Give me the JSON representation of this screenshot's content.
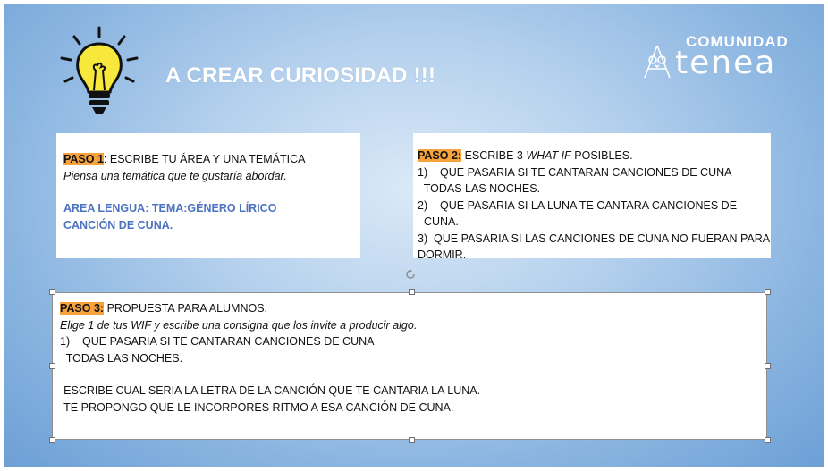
{
  "title": "A CREAR CURIOSIDAD !!!",
  "logo": {
    "top_text": "COMUNIDAD",
    "bottom_text": "tenea",
    "owl_icon": "owl-icon"
  },
  "colors": {
    "highlight": "#f7a23b",
    "accent_blue": "#4d73c0",
    "bulb_yellow": "#f7e83b"
  },
  "paso1": {
    "label": "PASO 1",
    "heading_rest": ": ESCRIBE TU ÁREA Y UNA TEMÁTICA",
    "hint": "Piensa una temática que te gustaría abordar.",
    "area_line1": "AREA LENGUA: TEMA:GÉNERO LÍRICO",
    "area_line2": "CANCIÓN DE CUNA."
  },
  "paso2": {
    "label": "PASO 2:",
    "heading_rest": " ESCRIBE 3 ",
    "heading_italic": "WHAT IF",
    "heading_end": " POSIBLES.",
    "items": [
      "1)    QUE PASARIA SI TE CANTARAN CANCIONES DE CUNA",
      "  TODAS LAS NOCHES.",
      "2)    QUE PASARIA SI LA LUNA TE CANTARA CANCIONES DE",
      "  CUNA.",
      "3)  QUE PASARIA SI LAS CANCIONES DE CUNA NO FUERAN PARA",
      "DORMIR."
    ]
  },
  "paso3": {
    "label": "PASO 3:",
    "heading_rest": " PROPUESTA PARA ALUMNOS.",
    "hint": "Elige 1 de tus WIF y escribe una consigna que los invite a producir algo.",
    "item_line1": "1)    QUE PASARIA SI TE CANTARAN CANCIONES DE CUNA",
    "item_line2": "  TODAS LAS NOCHES.",
    "task1": "-ESCRIBE CUAL SERIA LA LETRA DE LA CANCIÓN QUE TE CANTARIA LA LUNA.",
    "task2": "-TE PROPONGO QUE LE INCORPORES RITMO A ESA CANCIÓN DE CUNA."
  }
}
